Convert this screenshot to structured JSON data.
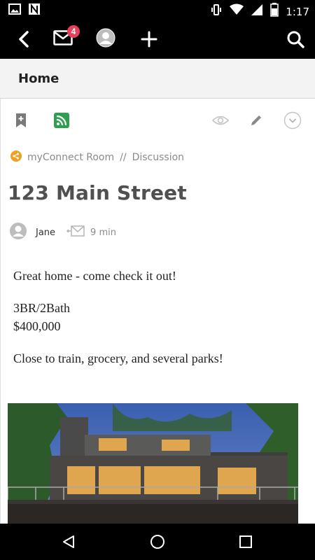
{
  "status_bar": {
    "time": "1:17",
    "icons": [
      "image-icon",
      "n-icon",
      "vibrate-icon",
      "wifi-icon",
      "signal-icon",
      "battery-icon"
    ]
  },
  "toolbar": {
    "back_icon": "back-arrow-icon",
    "messages_icon": "envelope-icon",
    "messages_badge": "4",
    "profile_icon": "avatar-icon",
    "add_icon": "plus-icon",
    "search_icon": "search-icon"
  },
  "page": {
    "title": "Home"
  },
  "actions": {
    "bookmark_icon": "bookmark-add-icon",
    "rss_icon": "rss-icon",
    "watch_icon": "eye-icon",
    "edit_icon": "pencil-icon",
    "more_icon": "chevron-down-circle-icon",
    "rss_color": "#2e9e4f"
  },
  "breadcrumb": {
    "place": "myConnect Room",
    "separator": "//",
    "section": "Discussion",
    "place_icon_color": "#f0a020"
  },
  "post": {
    "title": "123 Main Street",
    "author": "Jane",
    "time_ago": "9 min",
    "paragraphs": [
      "Great home - come check it out!",
      "3BR/2Bath",
      "$400,000",
      "Close to train, grocery, and several parks!"
    ]
  },
  "navbar": {
    "back": "triangle-back-icon",
    "home": "circle-home-icon",
    "recents": "square-recents-icon"
  }
}
